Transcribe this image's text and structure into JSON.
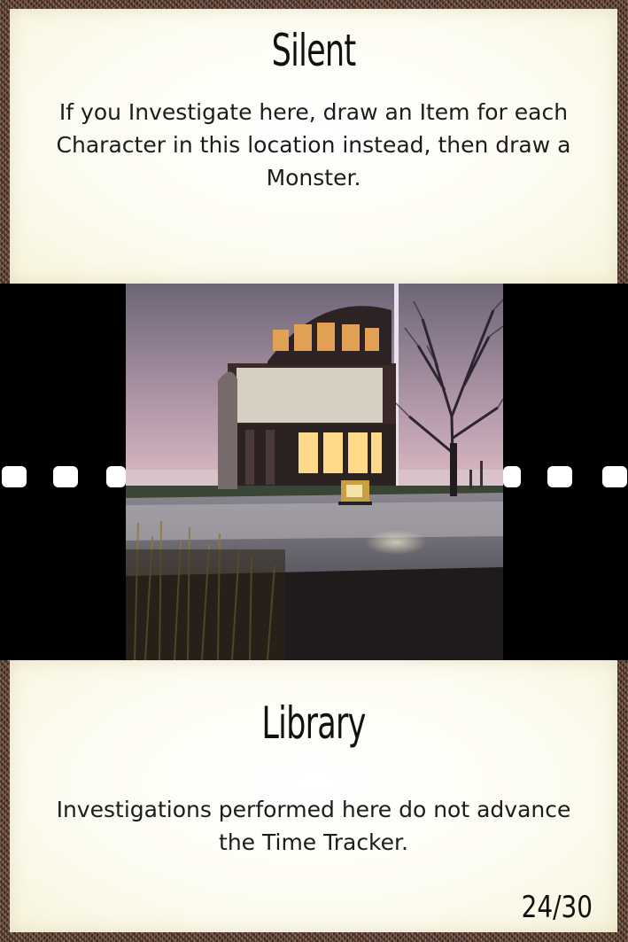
{
  "card": {
    "top": {
      "title": "Silent",
      "text": "If you Investigate here, draw an Item for each Character in this location instead, then draw a Monster."
    },
    "bottom": {
      "title": "Library",
      "text": "Investigations performed here do not advance the Time Tracker."
    },
    "counter": "24/30"
  },
  "colors": {
    "frame": "#5a3a2c",
    "panel": "#fdfcf2",
    "strip": "#000000",
    "text": "#111111"
  }
}
